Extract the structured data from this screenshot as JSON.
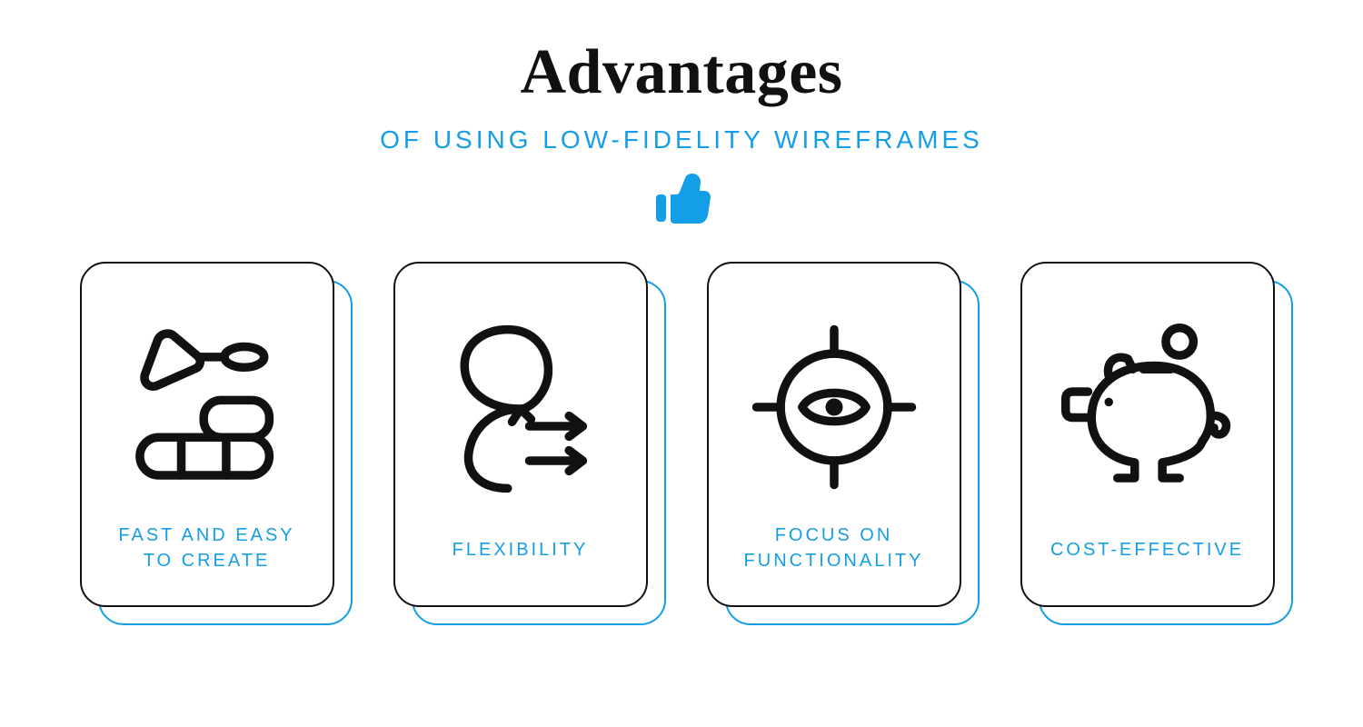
{
  "header": {
    "title": "Advantages",
    "subtitle": "OF USING LOW-FIDELITY WIREFRAMES"
  },
  "colors": {
    "accent": "#149EE7",
    "ink": "#111111"
  },
  "cards": [
    {
      "icon": "trowel-bricks-icon",
      "label": "FAST AND EASY TO CREATE"
    },
    {
      "icon": "flexibility-arrows-icon",
      "label": "FLEXIBILITY"
    },
    {
      "icon": "target-eye-icon",
      "label": "FOCUS ON FUNCTIONALITY"
    },
    {
      "icon": "piggy-bank-icon",
      "label": "COST-EFFECTIVE"
    }
  ]
}
